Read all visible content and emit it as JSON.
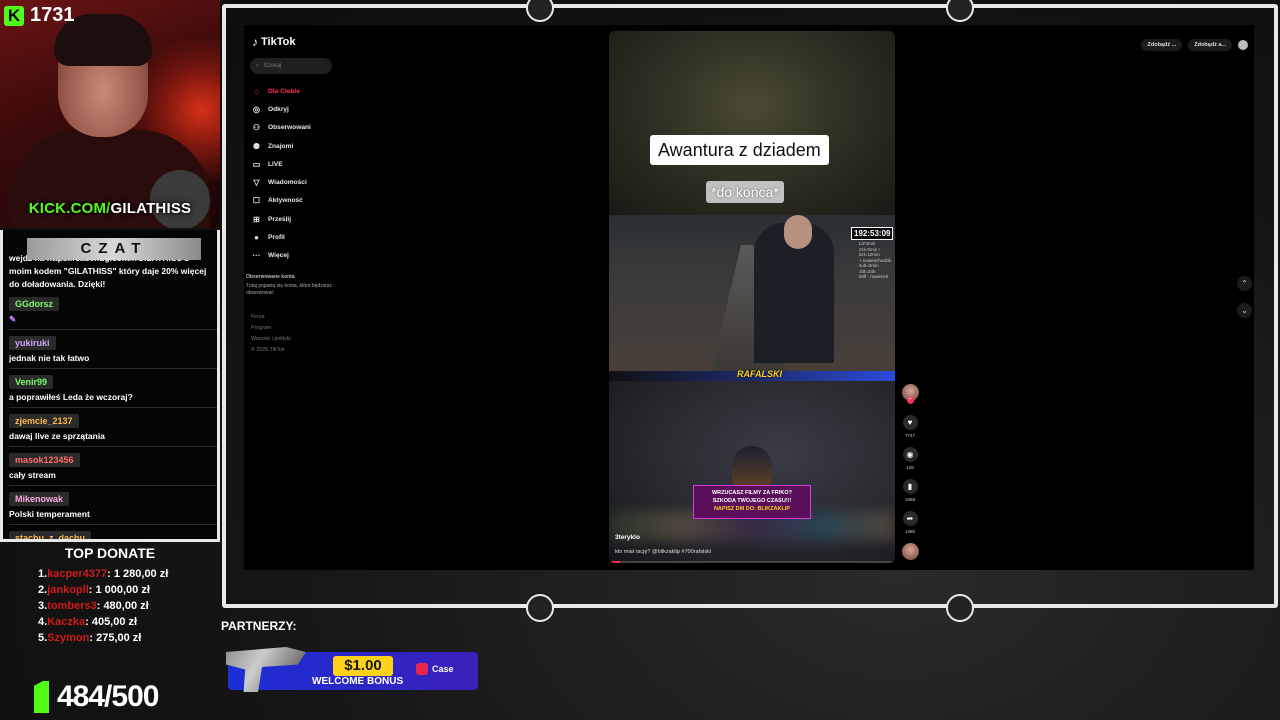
{
  "stream": {
    "viewer_count": "1731",
    "kick_url_prefix": "KICK.COM/",
    "kick_url_name": "GILATHISS",
    "followers": "484/500"
  },
  "chat": {
    "header": "CZAT",
    "intro": "wejdź na https://casehug.com/r/GILATHISS z moim kodem \"GILATHISS\" który daje 20% więcej do doładowania. Dzięki!",
    "messages": [
      {
        "user": "GGdorsz",
        "text": "",
        "color": "#7cfc6a"
      },
      {
        "user": "yukiruki",
        "text": "jednak nie tak łatwo",
        "color": "#c9a6ff"
      },
      {
        "user": "Venir99",
        "text": "a poprawiłeś Leda że wczoraj?",
        "color": "#7cfc6a"
      },
      {
        "user": "zjemcie_2137",
        "text": "dawaj live ze sprzątania",
        "color": "#ffb84d"
      },
      {
        "user": "masok123456",
        "text": "cały stream",
        "color": "#ff6b6b"
      },
      {
        "user": "Mikenowak",
        "text": "Polski temperament",
        "color": "#ffa8e0"
      },
      {
        "user": "stachu_z_dachu",
        "text": "no tak",
        "color": "#ffb84d"
      }
    ]
  },
  "donate": {
    "title": "TOP DONATE",
    "list": [
      {
        "rank": "1.",
        "name": "kacper4377",
        "amount": ": 1 280,00 zł"
      },
      {
        "rank": "2.",
        "name": "jankopll",
        "amount": ": 1 000,00 zł"
      },
      {
        "rank": "3.",
        "name": "tombers3",
        "amount": ": 480,00 zł"
      },
      {
        "rank": "4.",
        "name": "Kaczka",
        "amount": ": 405,00 zł"
      },
      {
        "rank": "5.",
        "name": "Szymon",
        "amount": ": 275,00 zł"
      }
    ]
  },
  "partners": {
    "label": "PARTNERZY:",
    "amount": "$1.00",
    "bonus": "WELCOME BONUS",
    "brand": "Case"
  },
  "tiktok": {
    "logo": "TikTok",
    "search_placeholder": "Szukaj",
    "nav": [
      {
        "label": "Dla Ciebie",
        "icon": "home-icon",
        "glyph": "⌂"
      },
      {
        "label": "Odkryj",
        "icon": "compass-icon",
        "glyph": "◎"
      },
      {
        "label": "Obserwowani",
        "icon": "user-follow-icon",
        "glyph": "⚇"
      },
      {
        "label": "Znajomi",
        "icon": "friends-icon",
        "glyph": "⚉"
      },
      {
        "label": "LIVE",
        "icon": "live-icon",
        "glyph": "▭"
      },
      {
        "label": "Wiadomości",
        "icon": "messages-icon",
        "glyph": "▽"
      },
      {
        "label": "Aktywność",
        "icon": "activity-icon",
        "glyph": "☐"
      },
      {
        "label": "Prześlij",
        "icon": "upload-icon",
        "glyph": "⊞"
      },
      {
        "label": "Profil",
        "icon": "profile-icon",
        "glyph": "●"
      },
      {
        "label": "Więcej",
        "icon": "more-icon",
        "glyph": "···"
      }
    ],
    "followed_heading": "Obserwowane konta",
    "followed_text": "Tutaj pojawią się konta, które będziesz obserwować",
    "footer": [
      "Firma",
      "Program",
      "Warunki i polityki",
      "© 2026 TikTok"
    ],
    "topright": [
      "Zdobądź ...",
      "Zdobądź a..."
    ]
  },
  "video": {
    "title": "Awantura z dziadem",
    "subtitle": "*do końca*",
    "timer": "192:53:09",
    "side_text": "Lit*3min\n2zł=5min +\n5zł=10min\n+ nowerichodzik\nsub=5min\n10f=24h\n50fl - nowerich",
    "streamer_tag": "RAFALSKI",
    "ad_line1": "WRZUCASZ FILMY ZA FRIKO?",
    "ad_line2": "SZKODA TWOJEGO CZASU!!!",
    "ad_line3": "NAPISZ DM DO: BLIKZAKLIP",
    "author": "3teryklo",
    "caption": "kto miał rację? @blikzaklip #700rafalski",
    "likes": "7747",
    "comments": "126",
    "saves": "1068",
    "shares": "1385",
    "progress": 0.04
  }
}
